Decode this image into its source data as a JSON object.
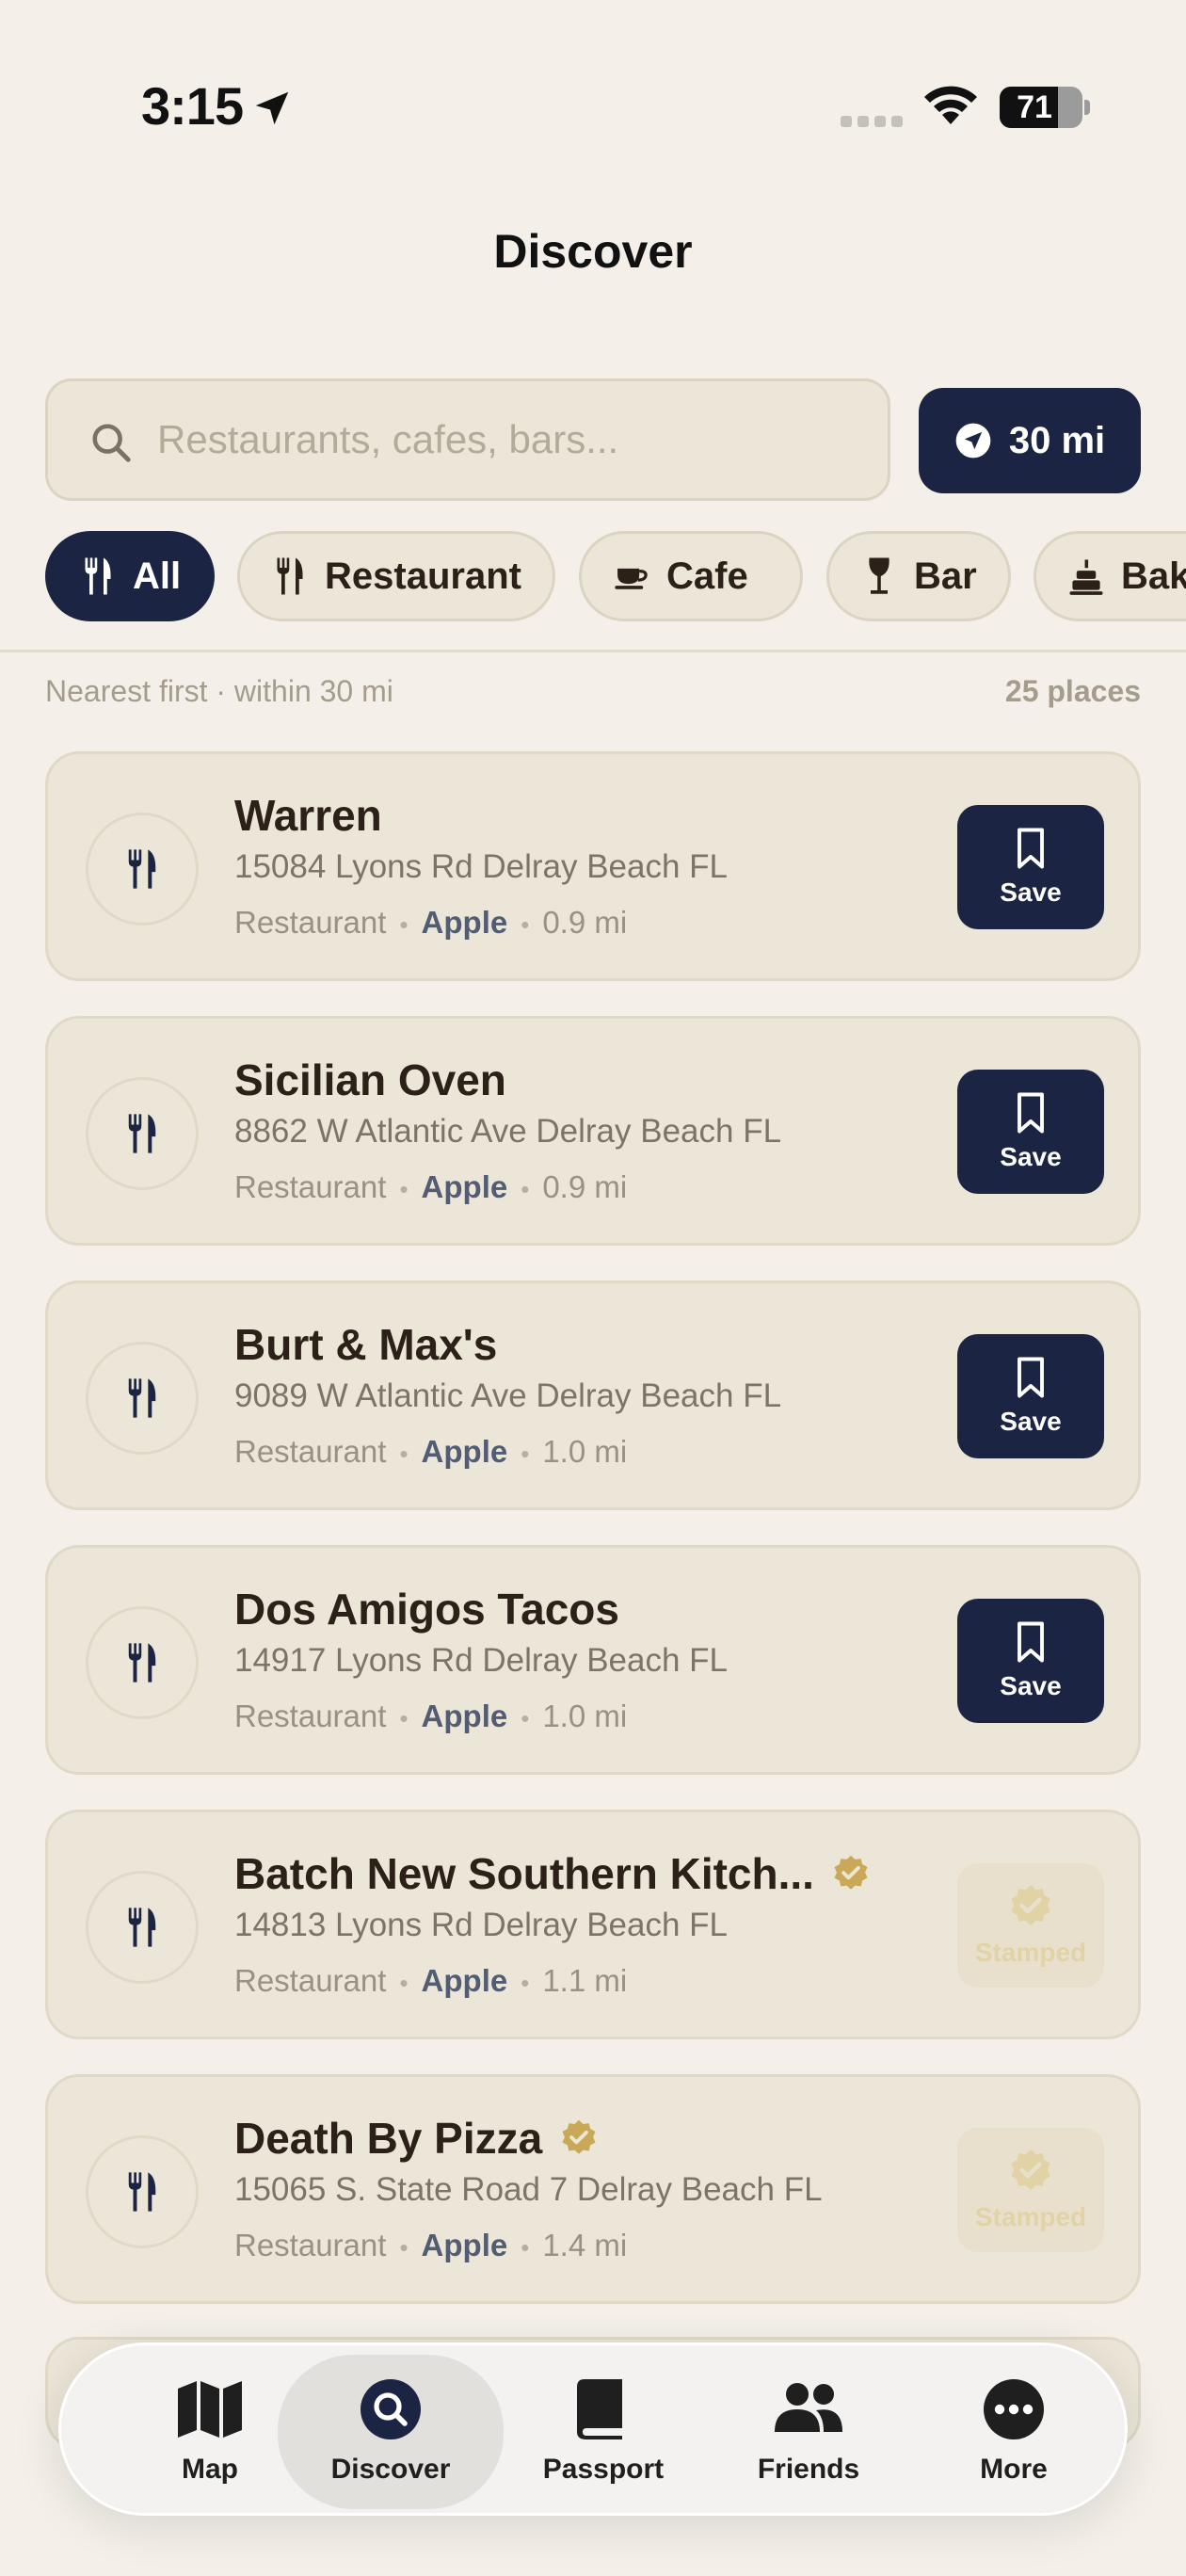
{
  "status_bar": {
    "time": "3:15",
    "battery": "71",
    "battery_level": 0.71
  },
  "title": "Discover",
  "search": {
    "placeholder": "Restaurants, cafes, bars...",
    "value": ""
  },
  "radius": {
    "label": "30 mi"
  },
  "filters": [
    {
      "label": "All",
      "icon": "fork-knife-icon",
      "active": true
    },
    {
      "label": "Restaurant",
      "icon": "fork-knife-icon",
      "active": false
    },
    {
      "label": "Cafe",
      "icon": "coffee-cup-icon",
      "active": false
    },
    {
      "label": "Bar",
      "icon": "wine-glass-icon",
      "active": false
    },
    {
      "label": "Bakery",
      "icon": "cake-icon",
      "active": false
    }
  ],
  "list_header": {
    "sort": "Nearest first · within 30 mi",
    "count": "25 places"
  },
  "places": [
    {
      "name": "Warren",
      "address": "15084 Lyons Rd Delray Beach FL",
      "category": "Restaurant",
      "source": "Apple",
      "distance": "0.9 mi",
      "stamped": false,
      "action": "Save"
    },
    {
      "name": "Sicilian Oven",
      "address": "8862 W Atlantic Ave Delray Beach FL",
      "category": "Restaurant",
      "source": "Apple",
      "distance": "0.9 mi",
      "stamped": false,
      "action": "Save"
    },
    {
      "name": "Burt & Max's",
      "address": "9089 W Atlantic Ave Delray Beach FL",
      "category": "Restaurant",
      "source": "Apple",
      "distance": "1.0 mi",
      "stamped": false,
      "action": "Save"
    },
    {
      "name": "Dos Amigos Tacos",
      "address": "14917 Lyons Rd Delray Beach FL",
      "category": "Restaurant",
      "source": "Apple",
      "distance": "1.0 mi",
      "stamped": false,
      "action": "Save"
    },
    {
      "name": "Batch New Southern Kitch...",
      "address": "14813 Lyons Rd Delray Beach FL",
      "category": "Restaurant",
      "source": "Apple",
      "distance": "1.1 mi",
      "stamped": true,
      "action": "Stamped"
    },
    {
      "name": "Death By Pizza",
      "address": "15065 S. State Road 7 Delray Beach FL",
      "category": "Restaurant",
      "source": "Apple",
      "distance": "1.4 mi",
      "stamped": true,
      "action": "Stamped"
    }
  ],
  "tabs": [
    {
      "label": "Map",
      "icon": "map-icon",
      "active": false
    },
    {
      "label": "Discover",
      "icon": "search-icon",
      "active": true
    },
    {
      "label": "Passport",
      "icon": "book-icon",
      "active": false
    },
    {
      "label": "Friends",
      "icon": "people-icon",
      "active": false
    },
    {
      "label": "More",
      "icon": "more-icon",
      "active": false
    }
  ],
  "colors": {
    "navy": "#1b2442",
    "background": "#f4f0e9",
    "card": "#ece6d8",
    "gold": "#c9a857"
  }
}
